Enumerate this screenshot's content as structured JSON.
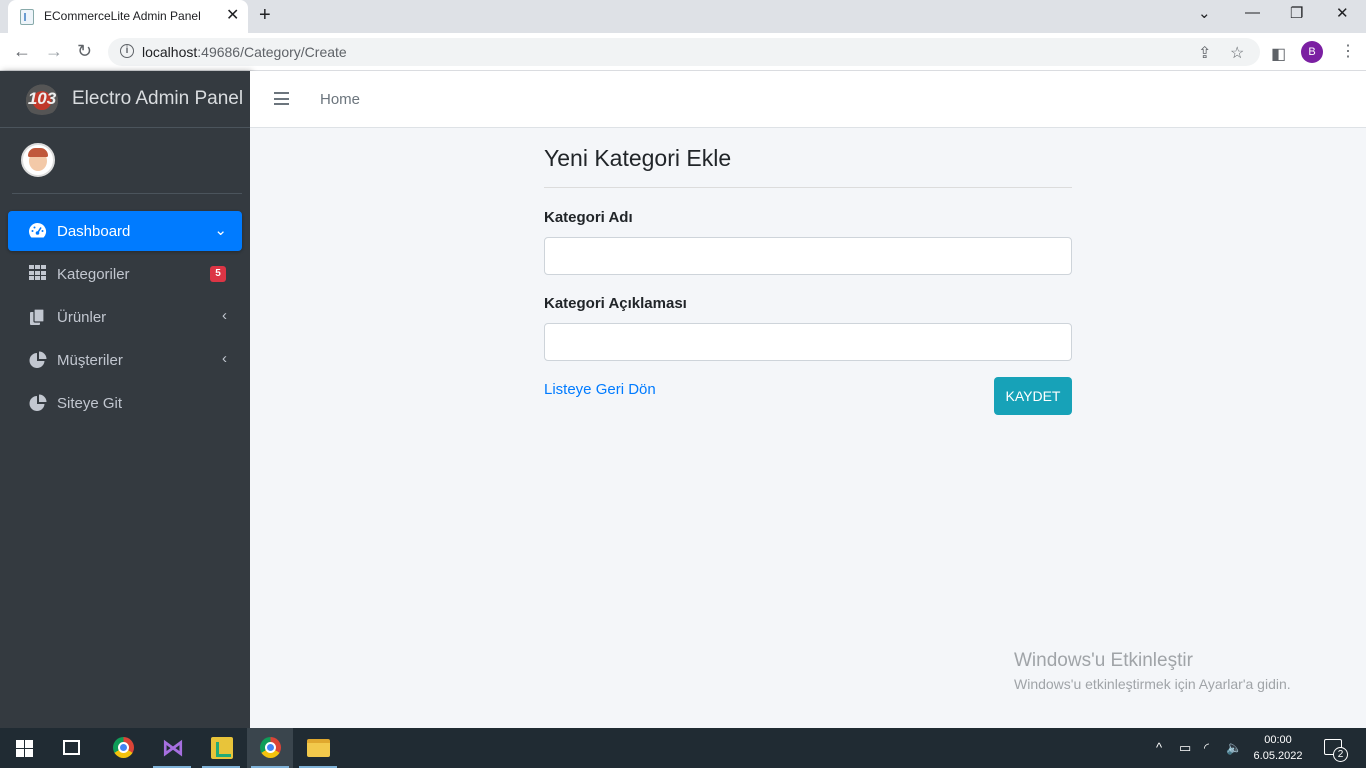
{
  "browser": {
    "tab_title": "ECommerceLite Admin Panel",
    "url_host": "localhost",
    "url_path": ":49686/Category/Create",
    "profile_initial": "B"
  },
  "sidebar": {
    "brand_logo_text": "103",
    "brand_name": "Electro Admin Panel",
    "items": [
      {
        "label": "Dashboard",
        "icon": "tachometer-icon",
        "active": true
      },
      {
        "label": "Kategoriler",
        "icon": "grid-icon",
        "badge": "5"
      },
      {
        "label": "Ürünler",
        "icon": "copy-icon"
      },
      {
        "label": "Müşteriler",
        "icon": "pie-chart-icon"
      },
      {
        "label": "Siteye Git",
        "icon": "pie-chart-icon"
      }
    ]
  },
  "topnav": {
    "home_label": "Home"
  },
  "form": {
    "title": "Yeni Kategori Ekle",
    "name_label": "Kategori Adı",
    "name_value": "",
    "description_label": "Kategori Açıklaması",
    "description_value": "",
    "back_link": "Listeye Geri Dön",
    "save_button": "KAYDET"
  },
  "watermark": {
    "line1": "Windows'u Etkinleştir",
    "line2": "Windows'u etkinleştirmek için Ayarlar'a gidin."
  },
  "taskbar": {
    "time": "00:00",
    "date": "6.05.2022",
    "notifications": "2"
  },
  "colors": {
    "sidebar_bg": "#343a40",
    "active_item": "#007bff",
    "save_button": "#17a2b8",
    "badge": "#dc3545",
    "link": "#007bff"
  }
}
